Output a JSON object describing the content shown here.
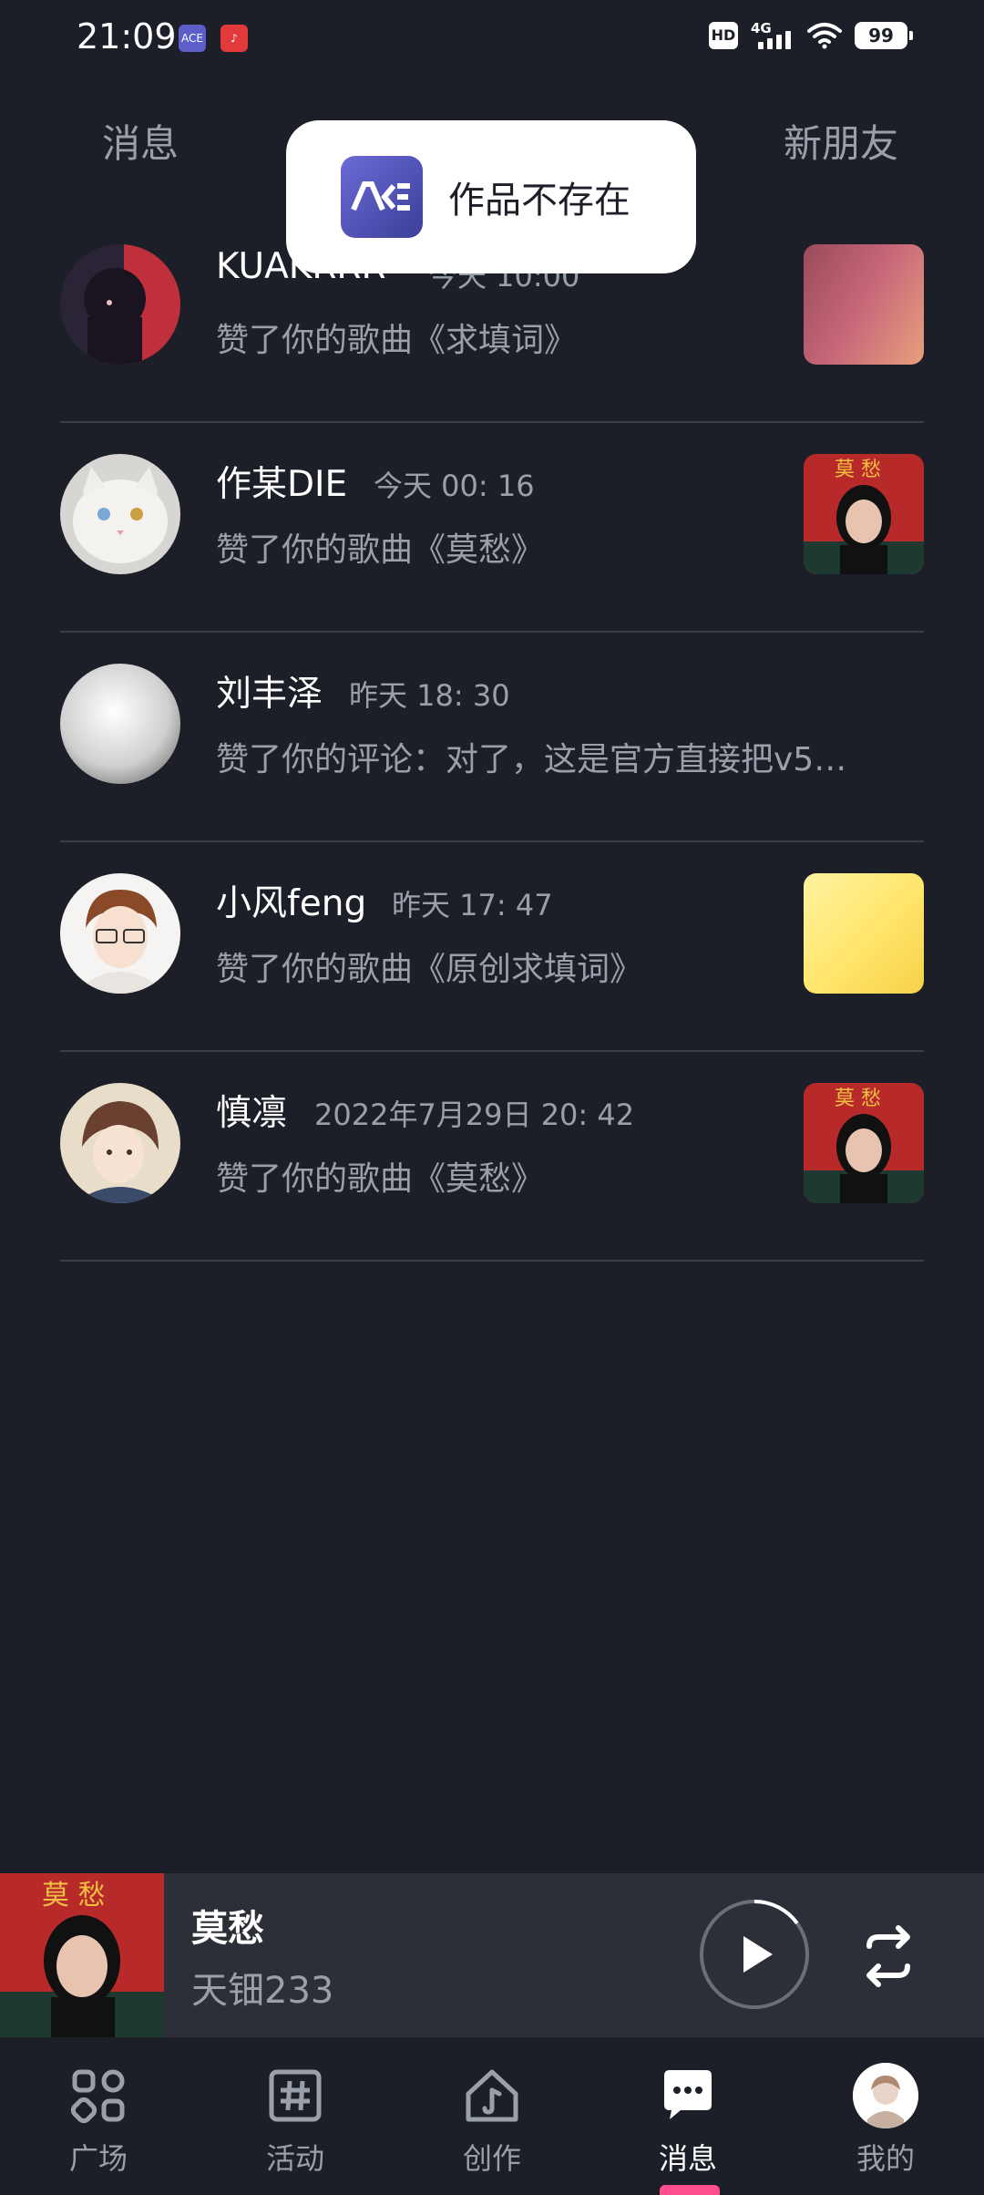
{
  "status_bar": {
    "time": "21:09",
    "hd": "HD",
    "network": "4G",
    "battery": "99"
  },
  "header": {
    "left_tab": "消息",
    "right_tab": "新朋友"
  },
  "toast": {
    "icon": "app-logo-icon",
    "text": "作品不存在"
  },
  "notifications": [
    {
      "name": "KUAKRRR",
      "time": "今天 10:00",
      "desc": "赞了你的歌曲《求填词》",
      "thumb": "pink-cover"
    },
    {
      "name": "作某DIE",
      "time": "今天 00: 16",
      "desc": "赞了你的歌曲《莫愁》",
      "thumb": "mochou-cover"
    },
    {
      "name": "刘丰泽",
      "time": "昨天  18: 30",
      "desc": "赞了你的评论：对了，这是官方直接把v5…",
      "thumb": ""
    },
    {
      "name": "小风feng",
      "time": "昨天  17: 47",
      "desc": "赞了你的歌曲《原创求填词》",
      "thumb": "yellow-cover"
    },
    {
      "name": "慎凛",
      "time": "2022年7月29日  20: 42",
      "desc": "赞了你的歌曲《莫愁》",
      "thumb": "mochou-cover"
    }
  ],
  "player": {
    "title": "莫愁",
    "artist": "天钿233",
    "progress": 0.15
  },
  "nav": {
    "items": [
      {
        "label": "广场",
        "icon": "grid-icon"
      },
      {
        "label": "活动",
        "icon": "hash-icon"
      },
      {
        "label": "创作",
        "icon": "home-create-icon"
      },
      {
        "label": "消息",
        "icon": "chat-icon"
      },
      {
        "label": "我的",
        "icon": "avatar-icon"
      }
    ],
    "active": "消息"
  },
  "colors": {
    "background": "#1c1f28",
    "accent": "#ff4d8d",
    "muted": "#9aa0aa"
  }
}
